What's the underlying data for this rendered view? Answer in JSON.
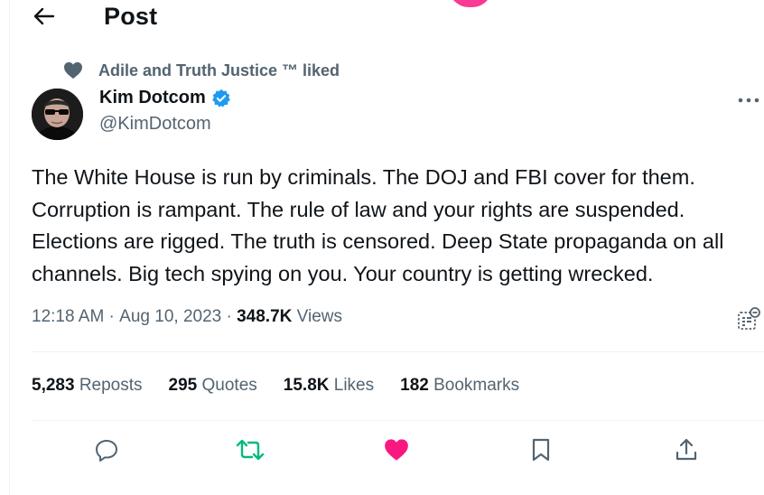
{
  "header": {
    "title": "Post",
    "back_icon": "arrow-left-icon"
  },
  "social_context": {
    "text": "Adile and Truth Justice ™ liked",
    "icon": "heart-icon"
  },
  "author": {
    "name": "Kim Dotcom",
    "handle": "@KimDotcom",
    "verified": true
  },
  "tweet": {
    "text": "The White House is run by criminals. The DOJ and FBI cover for them. Corruption is rampant. The rule of law and your rights are suspended. Elections are rigged. The truth is censored. Deep State propaganda on all channels. Big tech spying on you. Your country is getting wrecked."
  },
  "meta": {
    "time": "12:18 AM",
    "sep1": " · ",
    "date": "Aug 10, 2023",
    "sep2": " · ",
    "views_count": "348.7K",
    "views_label": " Views"
  },
  "stats": [
    {
      "count": "5,283",
      "label": " Reposts"
    },
    {
      "count": "295",
      "label": " Quotes"
    },
    {
      "count": "15.8K",
      "label": " Likes"
    },
    {
      "count": "182",
      "label": " Bookmarks"
    }
  ],
  "actions": [
    "reply-icon",
    "repost-icon",
    "like-icon",
    "bookmark-icon",
    "share-icon"
  ],
  "colors": {
    "text": "#0f1419",
    "secondary": "#536471",
    "verified": "#1d9bf0",
    "repost_active": "#00ba7c",
    "like_active": "#f91880",
    "divider": "#eff3f4"
  }
}
